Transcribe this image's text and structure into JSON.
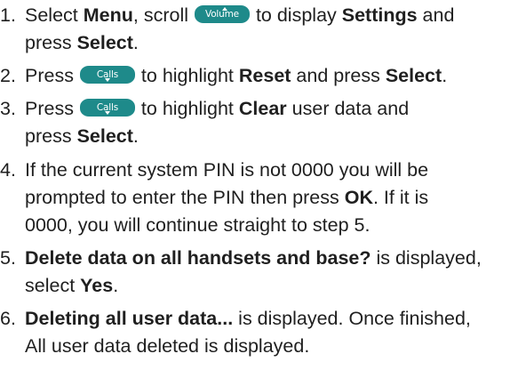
{
  "icons": {
    "volume_key_label": "Volume",
    "calls_key_label": "Calls",
    "key_color": "#1e8a8a"
  },
  "steps": [
    {
      "num": "1.",
      "l1a": "Select ",
      "l1b": "Menu",
      "l1c": ", scroll ",
      "l1d": " to display ",
      "l1e": "Settings",
      "l1f": " and",
      "l2a": "press ",
      "l2b": "Select",
      "l2c": "."
    },
    {
      "num": "2.",
      "a": "Press ",
      "b": " to highlight ",
      "c": "Reset",
      "d": " and press ",
      "e": "Select",
      "f": "."
    },
    {
      "num": "3.",
      "l1a": "Press ",
      "l1b": " to highlight ",
      "l1c": "Clear",
      "l1d": " user data and",
      "l2a": "press ",
      "l2b": "Select",
      "l2c": "."
    },
    {
      "num": "4.",
      "l1": "If the current system PIN is not 0000 you will be",
      "l2a": "prompted to enter the PIN then press ",
      "l2b": "OK",
      "l2c": ". If it is",
      "l3": "0000, you will continue straight to step 5."
    },
    {
      "num": "5.",
      "l1a": "Delete data on all handsets and base?",
      "l1b": " is displayed,",
      "l2a": "select ",
      "l2b": "Yes",
      "l2c": "."
    },
    {
      "num": "6.",
      "l1a": "Deleting all user data...",
      "l1b": " is displayed. Once finished,",
      "l2": "All user data deleted is displayed."
    }
  ]
}
